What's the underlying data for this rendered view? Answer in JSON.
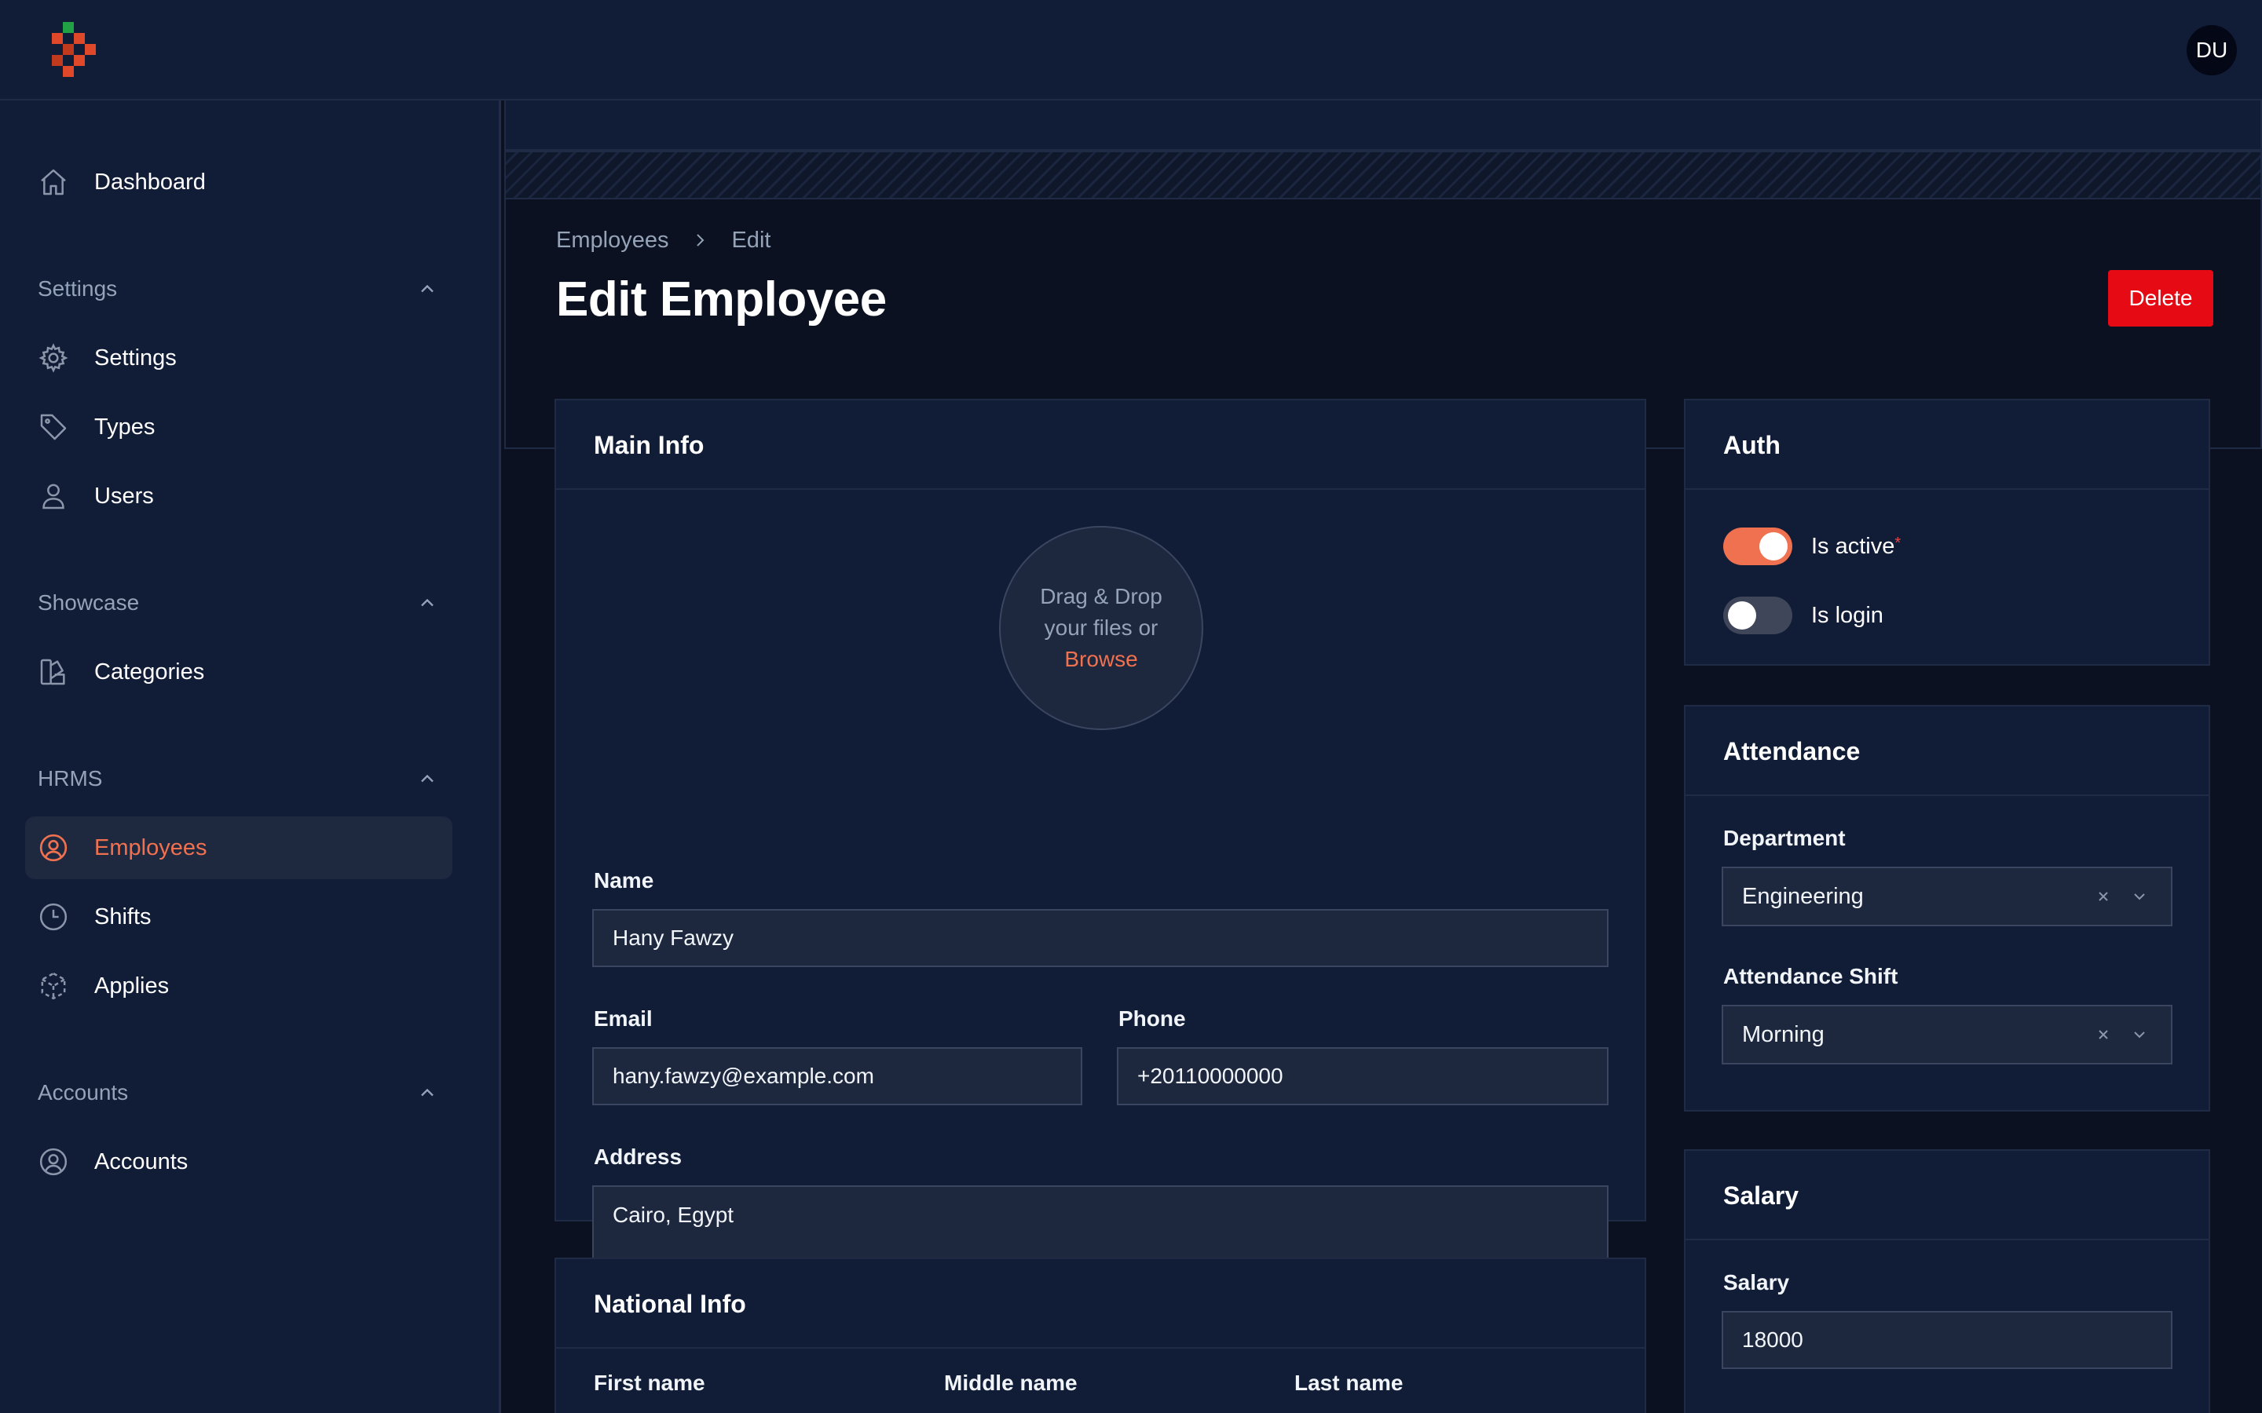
{
  "topbar": {
    "avatar_initials": "DU"
  },
  "sidebar": {
    "items": {
      "dashboard": "Dashboard",
      "settings": "Settings",
      "types": "Types",
      "users": "Users",
      "categories": "Categories",
      "employees": "Employees",
      "shifts": "Shifts",
      "applies": "Applies",
      "accounts": "Accounts"
    },
    "groups": {
      "settings": "Settings",
      "showcase": "Showcase",
      "hrms": "HRMS",
      "accounts": "Accounts"
    },
    "active_item": "Employees",
    "accent_color": "#f0714f"
  },
  "header": {
    "breadcrumb": [
      "Employees",
      "Edit"
    ],
    "title": "Edit Employee",
    "delete_label": "Delete"
  },
  "main_info": {
    "title": "Main Info",
    "upload": {
      "line1": "Drag & Drop",
      "line2": "your files or",
      "browse": "Browse"
    },
    "name_label": "Name",
    "name_value": "Hany Fawzy",
    "email_label": "Email",
    "email_value": "hany.fawzy@example.com",
    "phone_label": "Phone",
    "phone_value": "+20110000000",
    "address_label": "Address",
    "address_value": "Cairo, Egypt"
  },
  "national_info": {
    "title": "National Info",
    "first_name_label": "First name",
    "middle_name_label": "Middle name",
    "last_name_label": "Last name"
  },
  "auth": {
    "title": "Auth",
    "is_active_label": "Is active",
    "is_active_required": "*",
    "is_active": true,
    "is_login_label": "Is login",
    "is_login": false
  },
  "attendance": {
    "title": "Attendance",
    "department_label": "Department",
    "department_value": "Engineering",
    "shift_label": "Attendance Shift",
    "shift_value": "Morning"
  },
  "salary": {
    "title": "Salary",
    "salary_label": "Salary",
    "salary_value": "18000"
  }
}
